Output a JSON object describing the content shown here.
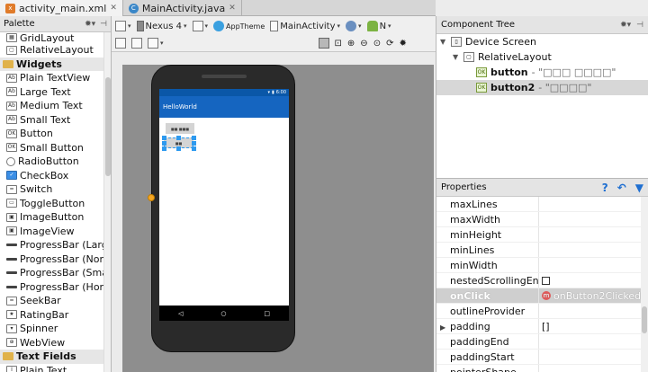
{
  "tabs": [
    {
      "label": "activity_main.xml",
      "active": true,
      "badge": "xml"
    },
    {
      "label": "MainActivity.java",
      "active": false,
      "badge": "C"
    }
  ],
  "palette": {
    "title": "Palette",
    "items_before": [
      "GridLayout",
      "RelativeLayout"
    ],
    "widgets_category": "Widgets",
    "widgets": [
      {
        "label": "Plain TextView",
        "icon": "text-icon"
      },
      {
        "label": "Large Text",
        "icon": "text-icon"
      },
      {
        "label": "Medium Text",
        "icon": "text-icon"
      },
      {
        "label": "Small Text",
        "icon": "text-icon"
      },
      {
        "label": "Button",
        "icon": "button-icon"
      },
      {
        "label": "Small Button",
        "icon": "button-icon"
      },
      {
        "label": "RadioButton",
        "icon": "radio-icon"
      },
      {
        "label": "CheckBox",
        "icon": "checkbox-icon"
      },
      {
        "label": "Switch",
        "icon": "switch-icon"
      },
      {
        "label": "ToggleButton",
        "icon": "toggle-icon"
      },
      {
        "label": "ImageButton",
        "icon": "image-icon"
      },
      {
        "label": "ImageView",
        "icon": "image-icon"
      },
      {
        "label": "ProgressBar (Large)",
        "icon": "progress-icon"
      },
      {
        "label": "ProgressBar (Normal)",
        "icon": "progress-icon"
      },
      {
        "label": "ProgressBar (Small)",
        "icon": "progress-icon"
      },
      {
        "label": "ProgressBar (Horizontal)",
        "icon": "progress-icon"
      },
      {
        "label": "SeekBar",
        "icon": "seekbar-icon"
      },
      {
        "label": "RatingBar",
        "icon": "rating-icon"
      },
      {
        "label": "Spinner",
        "icon": "spinner-icon"
      },
      {
        "label": "WebView",
        "icon": "web-icon"
      }
    ],
    "text_fields_category": "Text Fields",
    "items_after": [
      "Plain Text"
    ]
  },
  "toolbar": {
    "device": "Nexus 4",
    "theme": "AppTheme",
    "activity": "MainActivity",
    "api": "N"
  },
  "preview": {
    "app_title": "HelloWorld",
    "status_time": "6:00",
    "button1_text": "■■ ■■■",
    "button2_text": "■■"
  },
  "component_tree": {
    "title": "Component Tree",
    "nodes": [
      {
        "label": "Device Screen",
        "detail": ""
      },
      {
        "label": "RelativeLayout",
        "detail": ""
      },
      {
        "label": "button",
        "detail": " - \"□□□ □□□□\""
      },
      {
        "label": "button2",
        "detail": " - \"□□□□\""
      }
    ]
  },
  "properties": {
    "title": "Properties",
    "rows": [
      {
        "name": "maxLines",
        "value": ""
      },
      {
        "name": "maxWidth",
        "value": ""
      },
      {
        "name": "minHeight",
        "value": ""
      },
      {
        "name": "minLines",
        "value": ""
      },
      {
        "name": "minWidth",
        "value": ""
      },
      {
        "name": "nestedScrollingEnabled",
        "value": ""
      },
      {
        "name": "onClick",
        "value": "onButton2Clicked"
      },
      {
        "name": "outlineProvider",
        "value": ""
      },
      {
        "name": "padding",
        "value": "[]"
      },
      {
        "name": "paddingEnd",
        "value": ""
      },
      {
        "name": "paddingStart",
        "value": ""
      },
      {
        "name": "pointerShape",
        "value": ""
      }
    ]
  }
}
